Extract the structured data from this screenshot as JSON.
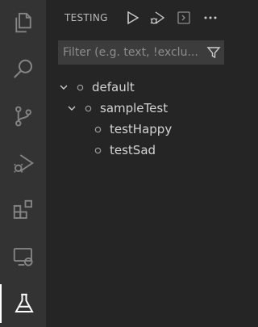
{
  "activity_bar": {
    "items": [
      {
        "name": "explorer-icon"
      },
      {
        "name": "search-icon"
      },
      {
        "name": "source-control-icon"
      },
      {
        "name": "run-debug-icon"
      },
      {
        "name": "extensions-icon"
      },
      {
        "name": "remote-explorer-icon"
      },
      {
        "name": "testing-beaker-icon",
        "active": true
      }
    ]
  },
  "header": {
    "title": "TESTING",
    "actions": [
      {
        "name": "run-all-tests-icon"
      },
      {
        "name": "debug-all-tests-icon"
      },
      {
        "name": "show-output-icon"
      },
      {
        "name": "more-actions-icon"
      }
    ]
  },
  "filter": {
    "placeholder": "Filter (e.g. text, !exclu...",
    "value": ""
  },
  "tree": {
    "items": [
      {
        "label": "default",
        "level": 0,
        "expanded": true
      },
      {
        "label": "sampleTest",
        "level": 1,
        "expanded": true
      },
      {
        "label": "testHappy",
        "level": 2
      },
      {
        "label": "testSad",
        "level": 2
      }
    ]
  },
  "colors": {
    "activity_bar_bg": "#333333",
    "sidebar_bg": "#252526",
    "icon_color": "#858585",
    "active_icon": "#ffffff",
    "input_bg": "#3c3c3c"
  }
}
